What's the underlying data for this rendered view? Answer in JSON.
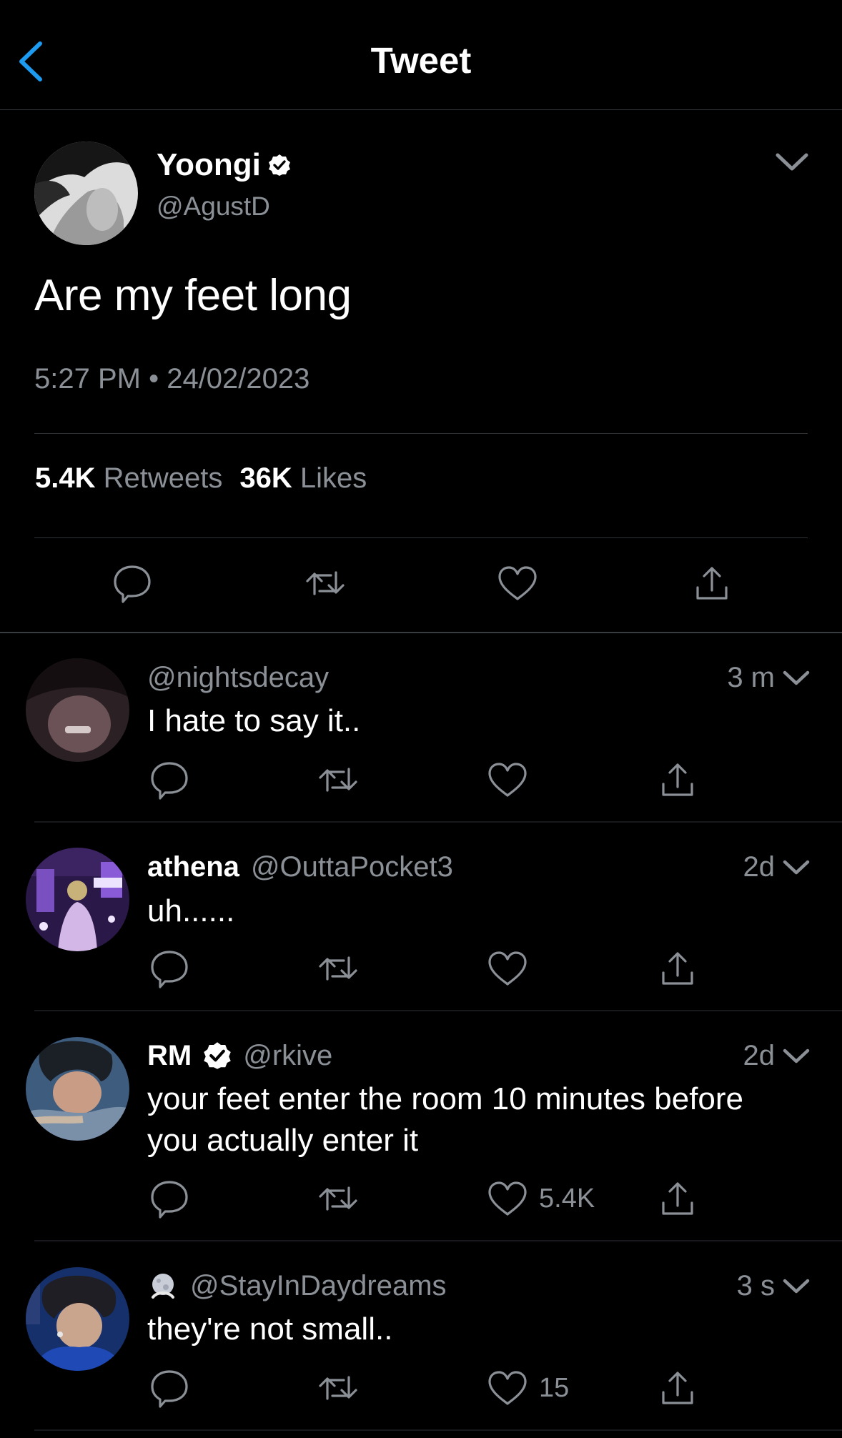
{
  "header": {
    "title": "Tweet"
  },
  "main_tweet": {
    "name": "Yoongi",
    "handle": "@AgustD",
    "text": "Are my feet long",
    "timestamp": "5:27 PM • 24/02/2023",
    "retweets_count": "5.4K",
    "retweets_label": "Retweets",
    "likes_count": "36K",
    "likes_label": "Likes"
  },
  "replies": [
    {
      "name": "",
      "handle": "@nightsdecay",
      "time": "3 m",
      "text": "I hate to say it..",
      "likes": ""
    },
    {
      "name": "athena",
      "handle": "@OuttaPocket3",
      "time": "2d",
      "text": "uh......",
      "likes": ""
    },
    {
      "name": "RM",
      "handle": "@rkive",
      "time": "2d",
      "text": "your feet enter the room 10 minutes before you actually enter it",
      "likes": "5.4K"
    },
    {
      "name": "",
      "handle": "@StayInDaydreams",
      "time": "3 s",
      "text": "they're not small..",
      "likes": "15"
    }
  ],
  "colors": {
    "accent": "#1d9bf0",
    "muted": "#8b9097",
    "background": "#000000",
    "divider": "#2f3336"
  },
  "icons": [
    "chevron-left-icon",
    "verified-badge-icon",
    "chevron-down-icon",
    "reply-icon",
    "retweet-icon",
    "like-icon",
    "share-icon",
    "moon-emoji-icon"
  ]
}
